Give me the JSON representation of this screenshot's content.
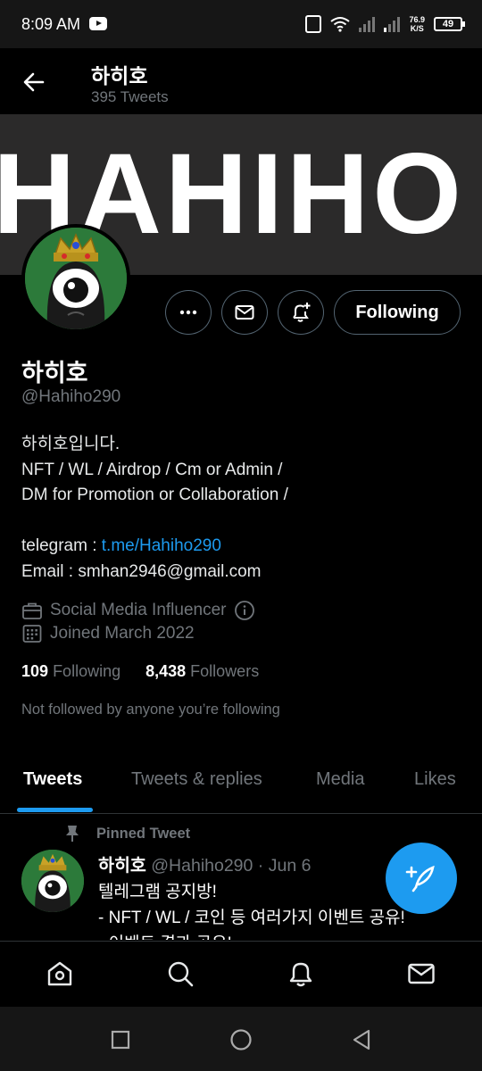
{
  "status_bar": {
    "time": "8:09 AM",
    "net_speed_value": "76.9",
    "net_speed_unit": "K/S",
    "battery": "49",
    "icons": [
      "youtube-icon",
      "vibrate-icon",
      "wifi-icon",
      "signal-icon",
      "battery-icon"
    ]
  },
  "header": {
    "name": "하히호",
    "tweet_count": "395 Tweets"
  },
  "banner": {
    "text": "HAHIHO"
  },
  "actions": {
    "following_label": "Following"
  },
  "profile": {
    "name": "하히호",
    "handle": "@Hahiho290",
    "bio_line1": "하히호입니다.",
    "bio_line2": "NFT / WL / Airdrop / Cm or Admin /",
    "bio_line3": "DM for Promotion or Collaboration /",
    "telegram_label": "telegram : ",
    "telegram_link": "t.me/Hahiho290",
    "email_line": "Email : smhan2946@gmail.com",
    "category": "Social Media Influencer",
    "joined": "Joined March 2022",
    "following_count": "109",
    "following_label": "Following",
    "followers_count": "8,438",
    "followers_label": "Followers",
    "not_followed": "Not followed by anyone you’re following"
  },
  "tabs": [
    {
      "label": "Tweets",
      "active": true
    },
    {
      "label": "Tweets & replies",
      "active": false
    },
    {
      "label": "Media",
      "active": false
    },
    {
      "label": "Likes",
      "active": false
    }
  ],
  "pinned_tweet": {
    "pinned_label": "Pinned Tweet",
    "author_name": "하히호",
    "author_handle": "@Hahiho290",
    "separator": "·",
    "date": "Jun 6",
    "line1": "텔레그램 공지방!",
    "line2": "- NFT / WL / 코인 등 여러가지 이벤트 공유!",
    "line3": "- 이벤트 결과 공유!"
  },
  "colors": {
    "accent": "#1d9bf0",
    "background": "#000000",
    "muted_text": "#71767b"
  }
}
